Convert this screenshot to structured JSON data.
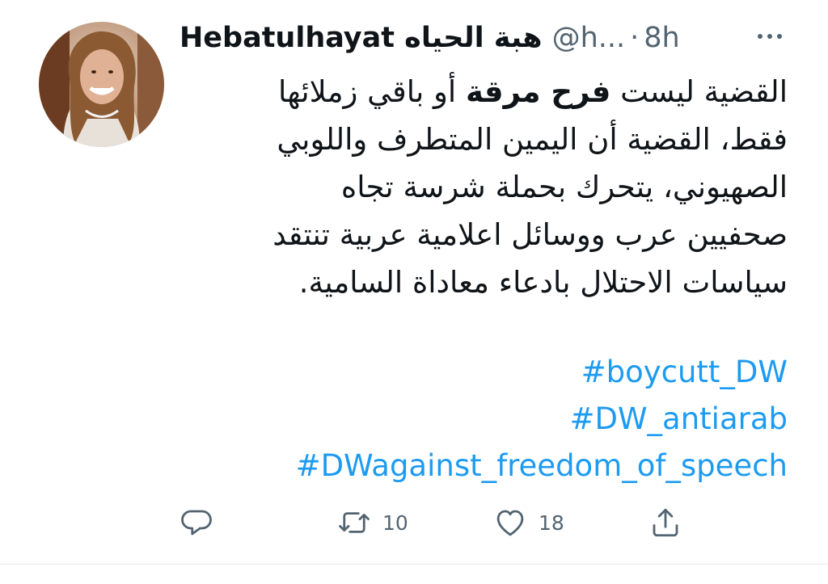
{
  "tweet": {
    "author": {
      "display_name": "Hebatulhayat هبة الحياه",
      "handle": "@h...",
      "separator": "·",
      "time": "8h"
    },
    "body": {
      "l1_pre": "القضية ليست ",
      "l1_bold": "فرح مرقة",
      "l1_post": " أو باقي زملائها",
      "l2": "فقط، القضية أن اليمين المتطرف واللوبي",
      "l3": "الصهيوني، يتحرك بحملة شرسة تجاه",
      "l4": "صحفيين عرب ووسائل اعلامية عربية تنتقد",
      "l5": "سياسات الاحتلال بادعاء معاداة السامية."
    },
    "hashtags": [
      "#boycutt_DW",
      "#DW_antiarab",
      "#DWagainst_freedom_of_speech"
    ],
    "actions": {
      "reply_icon": "reply-icon",
      "retweet_icon": "retweet-icon",
      "retweet_count": "10",
      "like_icon": "heart-icon",
      "like_count": "18",
      "share_icon": "share-icon"
    }
  },
  "colors": {
    "text": "#0f1419",
    "secondary": "#536471",
    "link": "#1d9bf0"
  }
}
